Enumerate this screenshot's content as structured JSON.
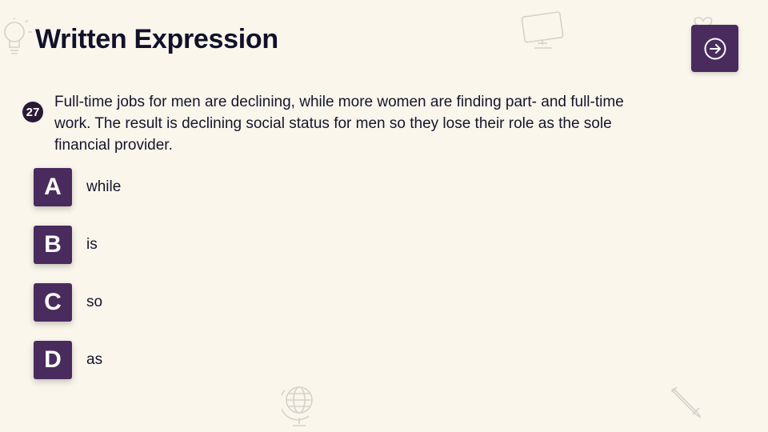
{
  "page": {
    "title": "Written Expression",
    "next_button_icon": "arrow-right-circle-icon"
  },
  "question": {
    "number": "27",
    "text": "Full-time jobs for men are declining, while more women are finding part- and full-time work. The result is declining social status for men so they lose their role as the sole financial provider."
  },
  "options": [
    {
      "letter": "A",
      "text": "while"
    },
    {
      "letter": "B",
      "text": "is"
    },
    {
      "letter": "C",
      "text": "so"
    },
    {
      "letter": "D",
      "text": "as"
    }
  ],
  "decorations": [
    "lightbulb-icon",
    "monitor-icon",
    "heart-icon",
    "globe-icon",
    "pencil-icon"
  ],
  "colors": {
    "background": "#faf6ec",
    "accent": "#4a2b5e",
    "text": "#14142a"
  }
}
